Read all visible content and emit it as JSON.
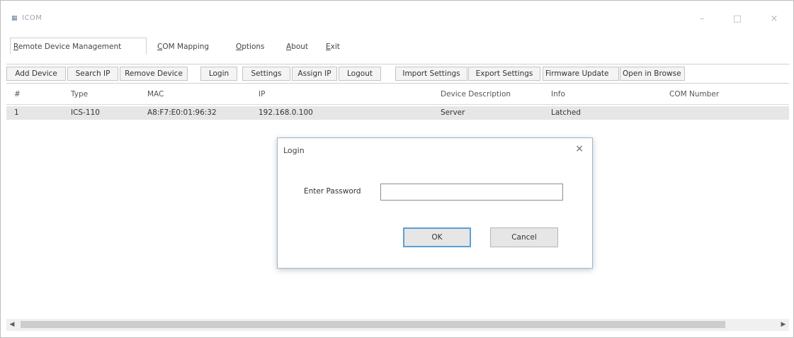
{
  "window": {
    "title": "ICOM",
    "minimize_glyph": "–",
    "maximize_glyph": "□",
    "close_glyph": "×"
  },
  "tabs": [
    {
      "prefix": "",
      "accel": "R",
      "rest": "emote Device Management",
      "active": true
    },
    {
      "prefix": "",
      "accel": "C",
      "rest": "OM Mapping",
      "active": false
    },
    {
      "prefix": "",
      "accel": "O",
      "rest": "ptions",
      "active": false
    },
    {
      "prefix": "",
      "accel": "A",
      "rest": "bout",
      "active": false
    },
    {
      "prefix": "",
      "accel": "E",
      "rest": "xit",
      "active": false
    }
  ],
  "toolbar": {
    "buttons": [
      "Add Device",
      "Search IP",
      "Remove Device",
      "Login",
      "Settings",
      "Assign IP",
      "Logout",
      "Import Settings",
      "Export Settings",
      "Firmware Update",
      "Open in Browse"
    ]
  },
  "table": {
    "columns": [
      "#",
      "Type",
      "MAC",
      "IP",
      "Device Description",
      "Info",
      "COM Number"
    ],
    "rows": [
      [
        "1",
        "ICS-110",
        "A8:F7:E0:01:96:32",
        "192.168.0.100",
        "Server",
        "Latched",
        ""
      ]
    ]
  },
  "dialog": {
    "title": "Login",
    "close_glyph": "×",
    "password_label": "Enter Password",
    "password_value": "",
    "ok_label": "OK",
    "cancel_label": "Cancel"
  },
  "scrollbar": {
    "left_glyph": "◀",
    "right_glyph": "▶"
  },
  "colors": {
    "selected_row": "#e6e6e6",
    "dialog_border": "#9bb7cf",
    "default_button_border": "#5b9fd4"
  }
}
